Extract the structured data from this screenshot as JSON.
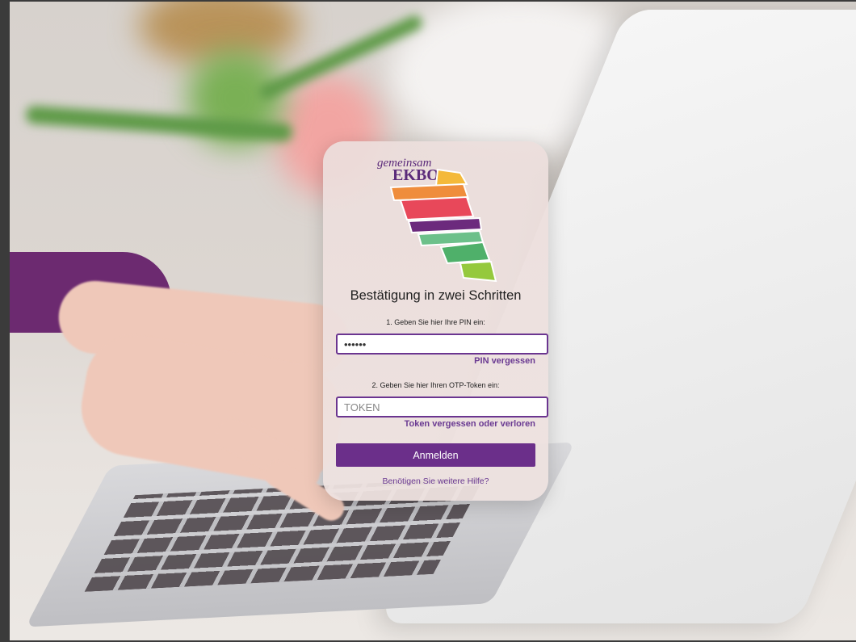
{
  "logo": {
    "text_top": "gemeinsam",
    "text_bottom": "EKBO"
  },
  "login": {
    "title": "Bestätigung in zwei Schritten",
    "step1_label": "1. Geben Sie hier Ihre PIN ein:",
    "pin_value": "••••••",
    "pin_forgot": "PIN vergessen",
    "step2_label": "2. Geben Sie hier Ihren OTP-Token ein:",
    "token_placeholder": "TOKEN",
    "token_forgot": "Token vergessen oder verloren",
    "submit": "Anmelden",
    "help": "Benötigen Sie weitere Hilfe?"
  },
  "colors": {
    "accent": "#6b2f8a",
    "link": "#6a3a92",
    "logo_stripes": [
      "#f4b93a",
      "#ef7d3c",
      "#e8485a",
      "#6c2a7d",
      "#6cc08a",
      "#4fb06a",
      "#95c93d"
    ]
  }
}
